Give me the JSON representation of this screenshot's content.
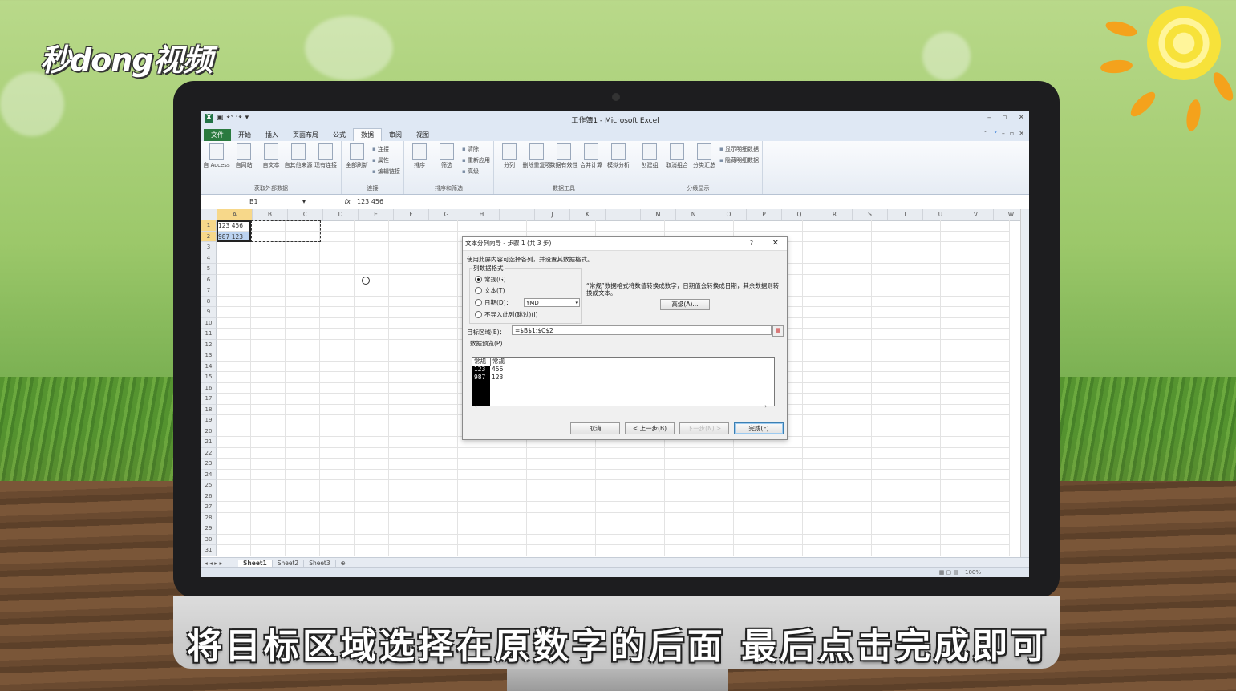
{
  "watermark": {
    "logo_text": "秒dong视频"
  },
  "caption": "将目标区域选择在原数字的后面  最后点击完成即可",
  "excel": {
    "title": "工作簿1 - Microsoft Excel",
    "tabs": [
      "文件",
      "开始",
      "插入",
      "页面布局",
      "公式",
      "数据",
      "审阅",
      "视图"
    ],
    "active_tab": "数据",
    "ribbon": {
      "groups": [
        {
          "label": "获取外部数据",
          "buttons": [
            "自 Access",
            "自网站",
            "自文本",
            "自其他来源",
            "现有连接"
          ]
        },
        {
          "label": "连接",
          "buttons": [
            "全部刷新"
          ],
          "small": [
            "连接",
            "属性",
            "编辑链接"
          ]
        },
        {
          "label": "排序和筛选",
          "buttons": [
            "排序",
            "筛选"
          ],
          "small": [
            "清除",
            "重新应用",
            "高级"
          ]
        },
        {
          "label": "数据工具",
          "buttons": [
            "分列",
            "删除重复项",
            "数据有效性",
            "合并计算",
            "模拟分析"
          ]
        },
        {
          "label": "分级显示",
          "buttons": [
            "创建组",
            "取消组合",
            "分类汇总"
          ],
          "small": [
            "显示明细数据",
            "隐藏明细数据"
          ]
        }
      ]
    },
    "name_box": "B1",
    "fx_label": "fx",
    "formula_value": "123 456",
    "columns": [
      "A",
      "B",
      "C",
      "D",
      "E",
      "F",
      "G",
      "H",
      "I",
      "J",
      "K",
      "L",
      "M",
      "N",
      "O",
      "P",
      "Q",
      "R",
      "S",
      "T",
      "U",
      "V",
      "W"
    ],
    "rows": [
      "1",
      "2",
      "3",
      "4",
      "5",
      "6",
      "7",
      "8",
      "9",
      "10",
      "11",
      "12",
      "13",
      "14",
      "15",
      "16",
      "17",
      "18",
      "19",
      "20",
      "21",
      "22",
      "23",
      "24",
      "25",
      "26",
      "27",
      "28",
      "29",
      "30",
      "31"
    ],
    "cells": {
      "A1": "123 456",
      "A2": "987 123"
    },
    "sheets": [
      "Sheet1",
      "Sheet2",
      "Sheet3"
    ],
    "zoom": "100%"
  },
  "dialog": {
    "title": "文本分列向导 - 步骤 1 (共 3 步)",
    "help": "?",
    "close": "✕",
    "instruction": "使用此屏内容可选择各列，并设置其数据格式。",
    "format_legend": "列数据格式",
    "options": [
      {
        "label": "常规(G)",
        "selected": true
      },
      {
        "label": "文本(T)",
        "selected": false
      },
      {
        "label": "日期(D)：",
        "selected": false
      },
      {
        "label": "不导入此列(跳过)(I)",
        "selected": false
      }
    ],
    "date_format": "YMD",
    "description": "“常规”数据格式将数值转换成数字，日期值会转换成日期，其余数据则转换成文本。",
    "advanced_button": "高级(A)...",
    "dest_label": "目标区域(E)：",
    "dest_value": "=$B$1:$C$2",
    "preview_label": "数据预览(P)",
    "preview_headers": [
      "常规",
      "常规"
    ],
    "preview_col1": [
      "123",
      "987"
    ],
    "preview_col2": [
      "456",
      "123"
    ],
    "buttons": {
      "cancel": "取消",
      "back": "< 上一步(B)",
      "next": "下一步(N) >",
      "finish": "完成(F)"
    }
  }
}
